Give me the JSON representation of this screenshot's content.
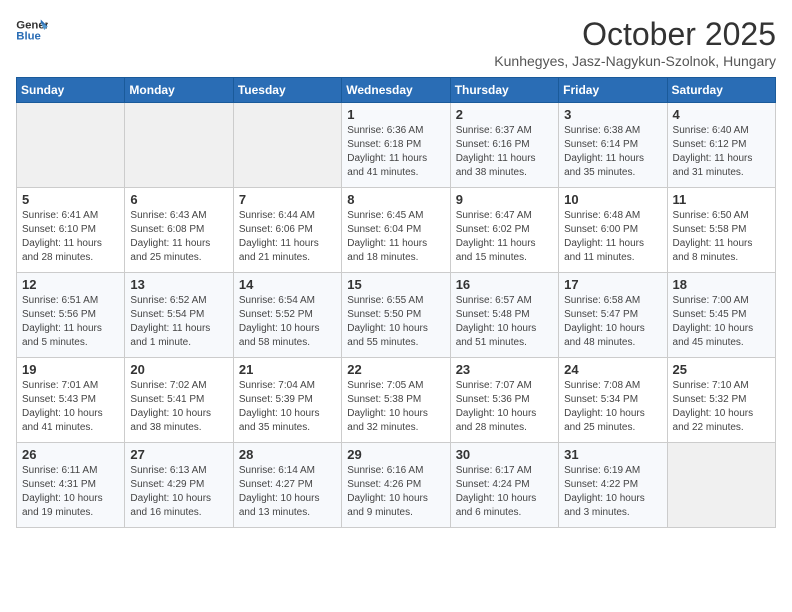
{
  "header": {
    "logo_line1": "General",
    "logo_line2": "Blue",
    "month_title": "October 2025",
    "subtitle": "Kunhegyes, Jasz-Nagykun-Szolnok, Hungary"
  },
  "weekdays": [
    "Sunday",
    "Monday",
    "Tuesday",
    "Wednesday",
    "Thursday",
    "Friday",
    "Saturday"
  ],
  "weeks": [
    [
      {
        "day": "",
        "content": ""
      },
      {
        "day": "",
        "content": ""
      },
      {
        "day": "",
        "content": ""
      },
      {
        "day": "1",
        "content": "Sunrise: 6:36 AM\nSunset: 6:18 PM\nDaylight: 11 hours\nand 41 minutes."
      },
      {
        "day": "2",
        "content": "Sunrise: 6:37 AM\nSunset: 6:16 PM\nDaylight: 11 hours\nand 38 minutes."
      },
      {
        "day": "3",
        "content": "Sunrise: 6:38 AM\nSunset: 6:14 PM\nDaylight: 11 hours\nand 35 minutes."
      },
      {
        "day": "4",
        "content": "Sunrise: 6:40 AM\nSunset: 6:12 PM\nDaylight: 11 hours\nand 31 minutes."
      }
    ],
    [
      {
        "day": "5",
        "content": "Sunrise: 6:41 AM\nSunset: 6:10 PM\nDaylight: 11 hours\nand 28 minutes."
      },
      {
        "day": "6",
        "content": "Sunrise: 6:43 AM\nSunset: 6:08 PM\nDaylight: 11 hours\nand 25 minutes."
      },
      {
        "day": "7",
        "content": "Sunrise: 6:44 AM\nSunset: 6:06 PM\nDaylight: 11 hours\nand 21 minutes."
      },
      {
        "day": "8",
        "content": "Sunrise: 6:45 AM\nSunset: 6:04 PM\nDaylight: 11 hours\nand 18 minutes."
      },
      {
        "day": "9",
        "content": "Sunrise: 6:47 AM\nSunset: 6:02 PM\nDaylight: 11 hours\nand 15 minutes."
      },
      {
        "day": "10",
        "content": "Sunrise: 6:48 AM\nSunset: 6:00 PM\nDaylight: 11 hours\nand 11 minutes."
      },
      {
        "day": "11",
        "content": "Sunrise: 6:50 AM\nSunset: 5:58 PM\nDaylight: 11 hours\nand 8 minutes."
      }
    ],
    [
      {
        "day": "12",
        "content": "Sunrise: 6:51 AM\nSunset: 5:56 PM\nDaylight: 11 hours\nand 5 minutes."
      },
      {
        "day": "13",
        "content": "Sunrise: 6:52 AM\nSunset: 5:54 PM\nDaylight: 11 hours\nand 1 minute."
      },
      {
        "day": "14",
        "content": "Sunrise: 6:54 AM\nSunset: 5:52 PM\nDaylight: 10 hours\nand 58 minutes."
      },
      {
        "day": "15",
        "content": "Sunrise: 6:55 AM\nSunset: 5:50 PM\nDaylight: 10 hours\nand 55 minutes."
      },
      {
        "day": "16",
        "content": "Sunrise: 6:57 AM\nSunset: 5:48 PM\nDaylight: 10 hours\nand 51 minutes."
      },
      {
        "day": "17",
        "content": "Sunrise: 6:58 AM\nSunset: 5:47 PM\nDaylight: 10 hours\nand 48 minutes."
      },
      {
        "day": "18",
        "content": "Sunrise: 7:00 AM\nSunset: 5:45 PM\nDaylight: 10 hours\nand 45 minutes."
      }
    ],
    [
      {
        "day": "19",
        "content": "Sunrise: 7:01 AM\nSunset: 5:43 PM\nDaylight: 10 hours\nand 41 minutes."
      },
      {
        "day": "20",
        "content": "Sunrise: 7:02 AM\nSunset: 5:41 PM\nDaylight: 10 hours\nand 38 minutes."
      },
      {
        "day": "21",
        "content": "Sunrise: 7:04 AM\nSunset: 5:39 PM\nDaylight: 10 hours\nand 35 minutes."
      },
      {
        "day": "22",
        "content": "Sunrise: 7:05 AM\nSunset: 5:38 PM\nDaylight: 10 hours\nand 32 minutes."
      },
      {
        "day": "23",
        "content": "Sunrise: 7:07 AM\nSunset: 5:36 PM\nDaylight: 10 hours\nand 28 minutes."
      },
      {
        "day": "24",
        "content": "Sunrise: 7:08 AM\nSunset: 5:34 PM\nDaylight: 10 hours\nand 25 minutes."
      },
      {
        "day": "25",
        "content": "Sunrise: 7:10 AM\nSunset: 5:32 PM\nDaylight: 10 hours\nand 22 minutes."
      }
    ],
    [
      {
        "day": "26",
        "content": "Sunrise: 6:11 AM\nSunset: 4:31 PM\nDaylight: 10 hours\nand 19 minutes."
      },
      {
        "day": "27",
        "content": "Sunrise: 6:13 AM\nSunset: 4:29 PM\nDaylight: 10 hours\nand 16 minutes."
      },
      {
        "day": "28",
        "content": "Sunrise: 6:14 AM\nSunset: 4:27 PM\nDaylight: 10 hours\nand 13 minutes."
      },
      {
        "day": "29",
        "content": "Sunrise: 6:16 AM\nSunset: 4:26 PM\nDaylight: 10 hours\nand 9 minutes."
      },
      {
        "day": "30",
        "content": "Sunrise: 6:17 AM\nSunset: 4:24 PM\nDaylight: 10 hours\nand 6 minutes."
      },
      {
        "day": "31",
        "content": "Sunrise: 6:19 AM\nSunset: 4:22 PM\nDaylight: 10 hours\nand 3 minutes."
      },
      {
        "day": "",
        "content": ""
      }
    ]
  ]
}
